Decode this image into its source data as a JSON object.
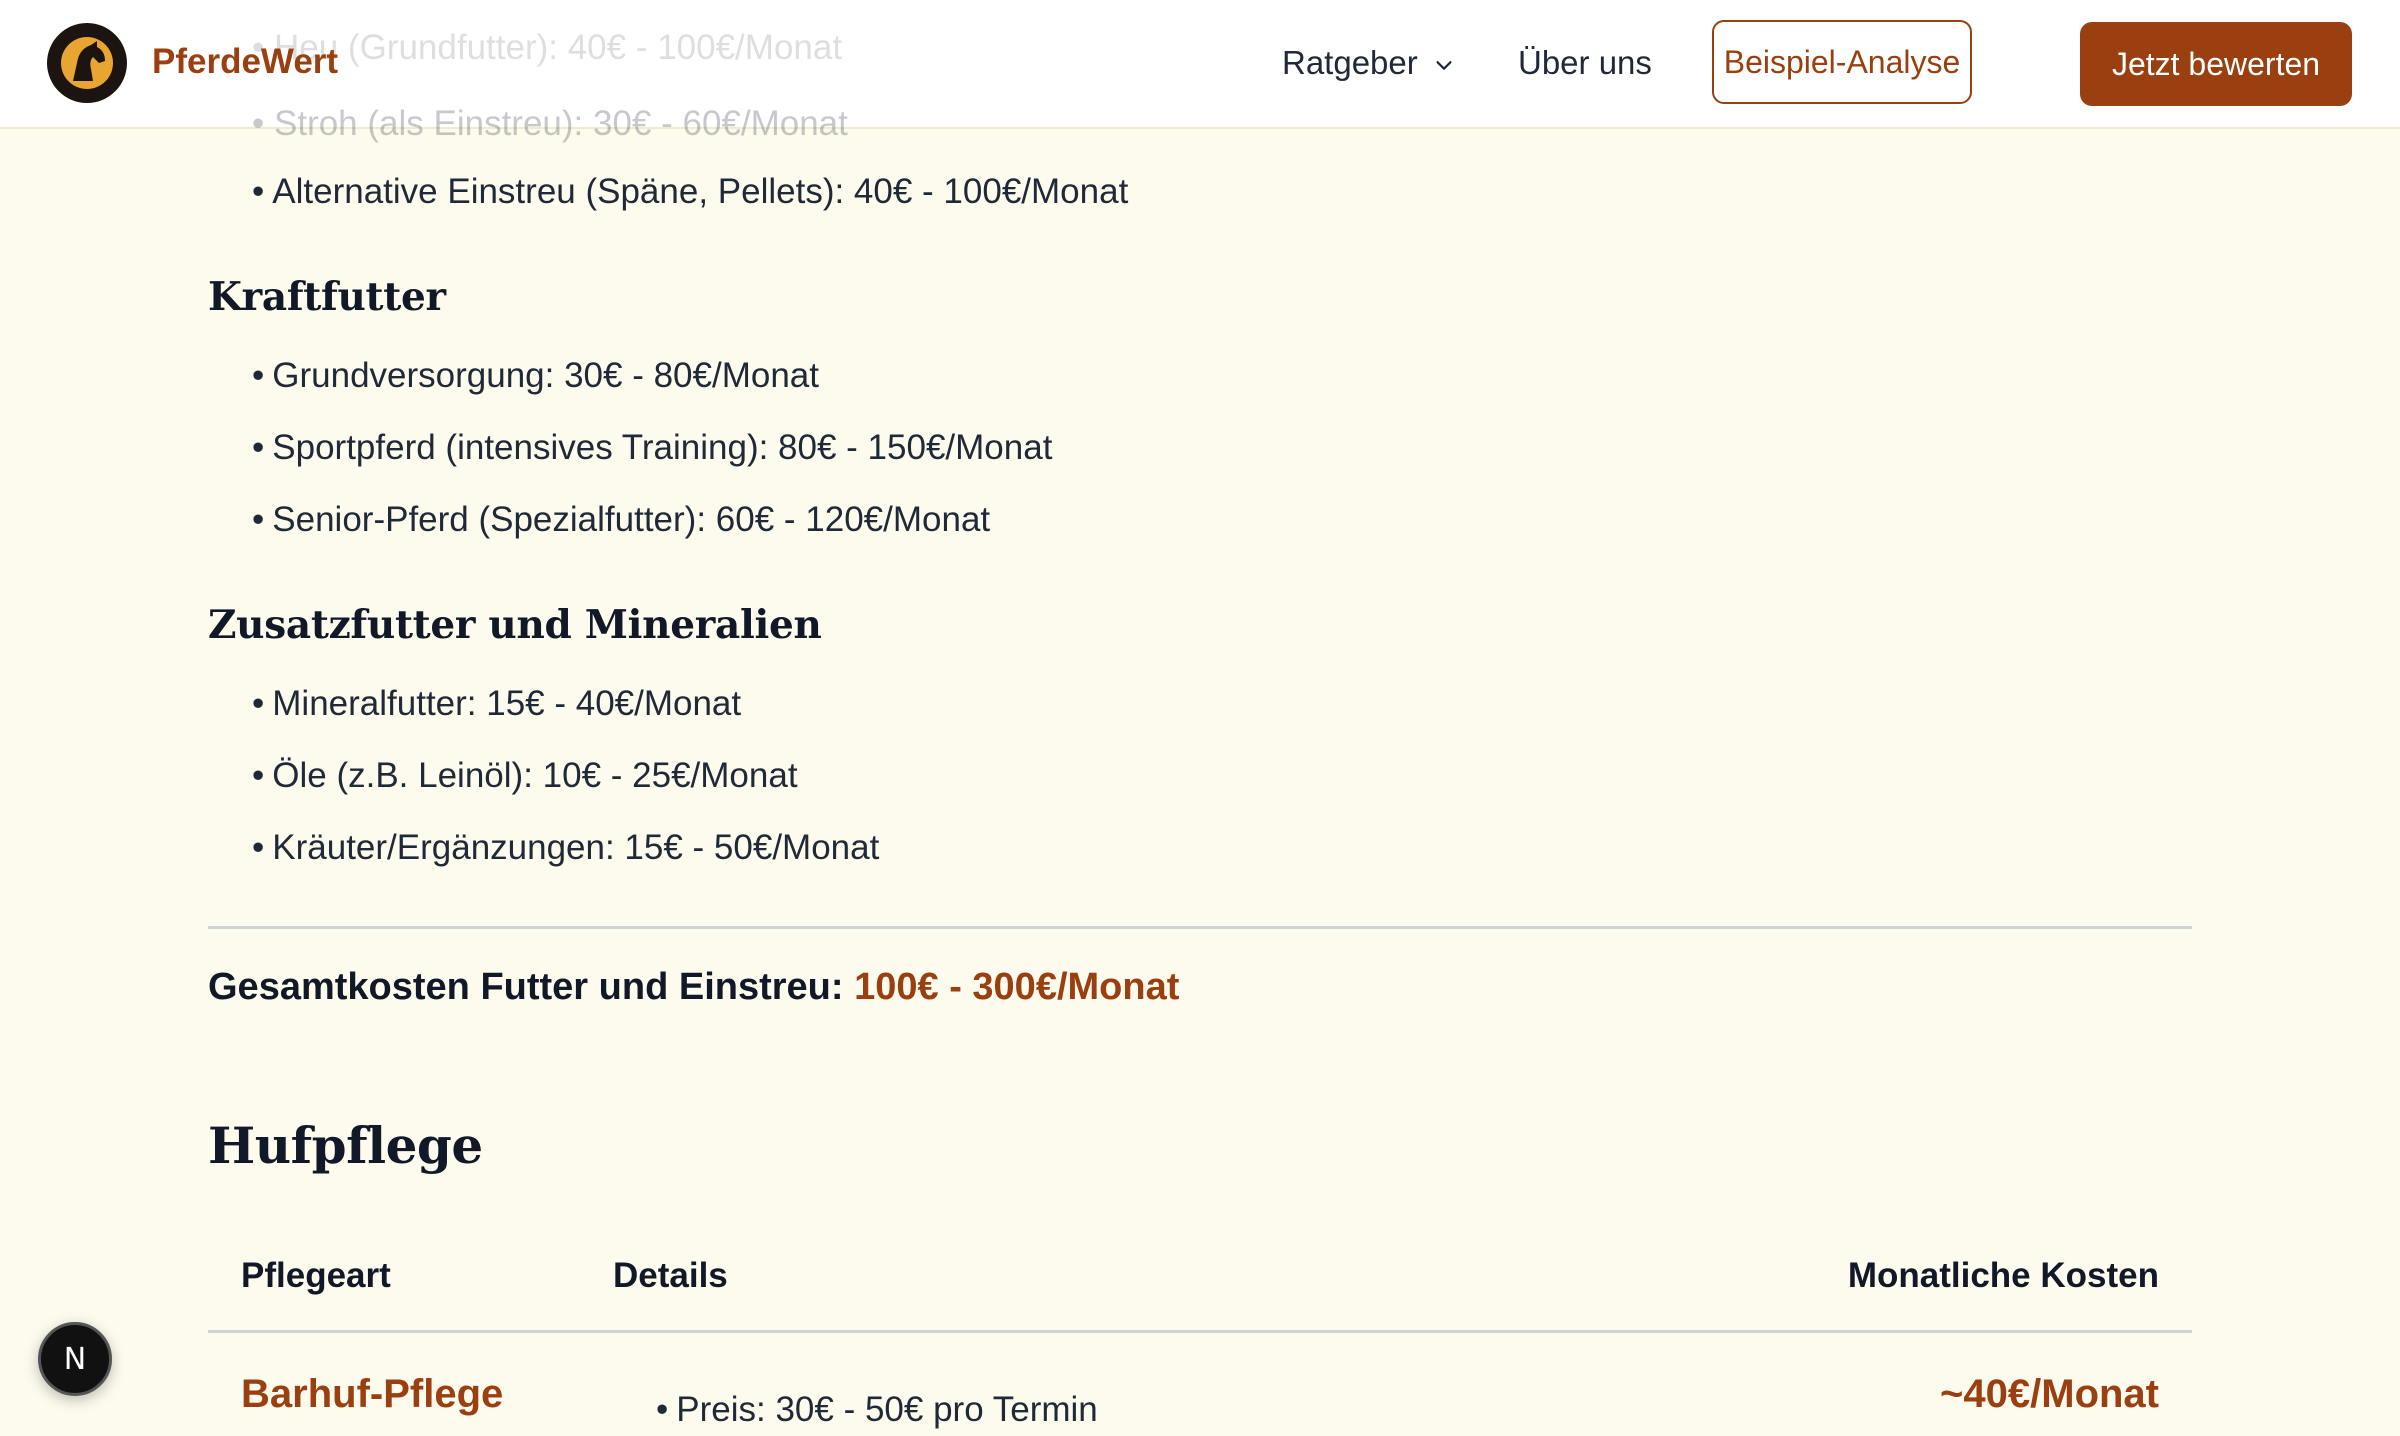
{
  "header": {
    "brand": "PferdeWert",
    "nav": {
      "ratgeber": "Ratgeber",
      "ueber_uns": "Über uns",
      "example_button": "Beispiel-Analyse",
      "cta_button": "Jetzt bewerten"
    },
    "behind_header_text": [
      "• Heu (Grundfutter): 40€ - 100€/Monat",
      "• Stroh (als Einstreu): 30€ - 60€/Monat"
    ]
  },
  "einstreu": {
    "items": [
      "Alternative Einstreu (Späne, Pellets): 40€ - 100€/Monat"
    ]
  },
  "kraftfutter": {
    "title": "Kraftfutter",
    "items": [
      "Grundversorgung: 30€ - 80€/Monat",
      "Sportpferd (intensives Training): 80€ - 150€/Monat",
      "Senior-Pferd (Spezialfutter): 60€ - 120€/Monat"
    ]
  },
  "zusatzfutter": {
    "title": "Zusatzfutter und Mineralien",
    "items": [
      "Mineralfutter: 15€ - 40€/Monat",
      "Öle (z.B. Leinöl): 10€ - 25€/Monat",
      "Kräuter/Ergänzungen: 15€ - 50€/Monat"
    ]
  },
  "total": {
    "label": "Gesamtkosten Futter und Einstreu:",
    "value": "100€ - 300€/Monat"
  },
  "hufpflege": {
    "title": "Hufpflege",
    "columns": [
      "Pflegeart",
      "Details",
      "Monatliche Kosten"
    ],
    "rows": [
      {
        "type": "Barhuf-Pflege",
        "details": [
          "Preis: 30€ - 50€ pro Termin"
        ],
        "monthly": "~40€/Monat"
      }
    ]
  },
  "dev_badge": "N",
  "colors": {
    "accent": "#9a3f0f",
    "background": "#fdfaee",
    "header_bg": "#ffffff"
  }
}
